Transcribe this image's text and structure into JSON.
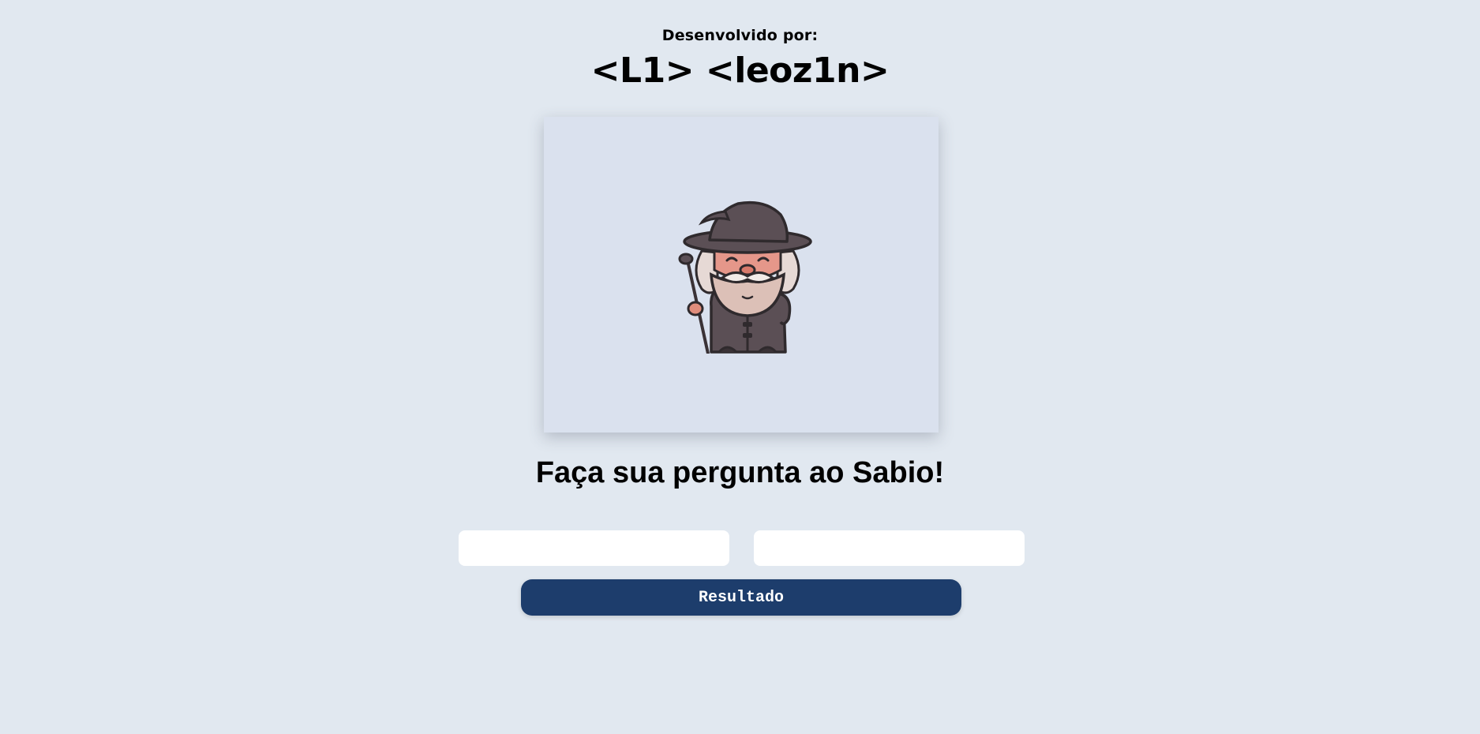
{
  "header": {
    "credit_label": "Desenvolvido por:",
    "credit_name": "<L1> <leoz1n>"
  },
  "hero": {
    "image_icon": "wizard-illustration"
  },
  "main": {
    "heading": "Faça sua pergunta ao Sabio!",
    "inputs": [
      {
        "value": "",
        "placeholder": ""
      },
      {
        "value": "",
        "placeholder": ""
      }
    ],
    "button_label": "Resultado"
  },
  "colors": {
    "background": "#e1e8f0",
    "card": "#dae1ee",
    "button": "#1d3d6c",
    "button_text": "#ffffff"
  }
}
